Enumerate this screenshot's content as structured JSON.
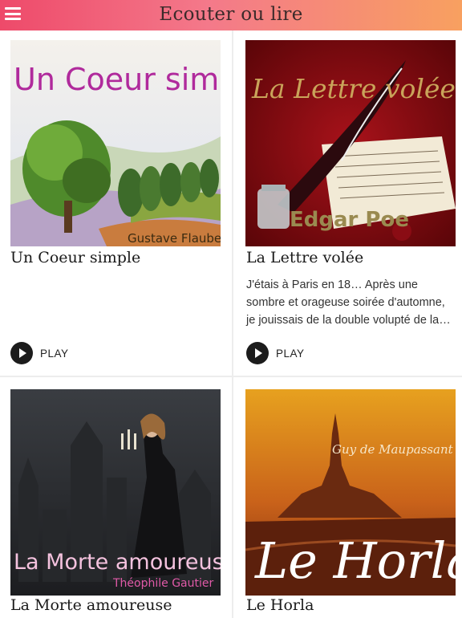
{
  "header": {
    "title": "Ecouter ou lire",
    "menu_icon": "hamburger-menu-icon"
  },
  "cards": [
    {
      "title": "Un Coeur simple",
      "cover_title": "Un Coeur simple",
      "cover_author": "Gustave Flaubert",
      "description": "",
      "play_label": "PLAY"
    },
    {
      "title": "La Lettre volée",
      "cover_title": "La Lettre volée",
      "cover_author": "Edgar Poe",
      "description": "J'étais à Paris en 18… Après une sombre et orageuse soirée d'automne, je jouissais de la double volupté de la…",
      "play_label": "PLAY"
    },
    {
      "title": "La Morte amoureuse",
      "cover_title": "La Morte amoureuse",
      "cover_author": "Théophile Gautier"
    },
    {
      "title": "Le Horla",
      "cover_title": "Le Horla",
      "cover_author": "Guy de Maupassant"
    }
  ]
}
